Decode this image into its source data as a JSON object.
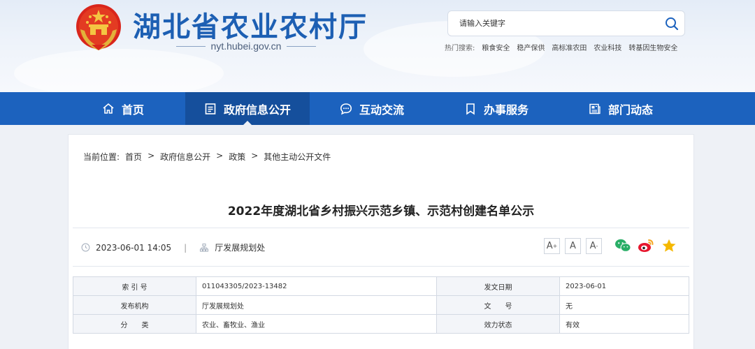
{
  "header": {
    "site_title": "湖北省农业农村厅",
    "domain": "nyt.hubei.gov.cn",
    "search": {
      "placeholder": "请输入关键字"
    },
    "hot_label": "热门搜索:",
    "hot_items": [
      "粮食安全",
      "稳产保供",
      "高标准农田",
      "农业科技",
      "转基因生物安全"
    ]
  },
  "nav": {
    "items": [
      {
        "label": "首页",
        "icon": "home-icon"
      },
      {
        "label": "政府信息公开",
        "icon": "document-list-icon",
        "active": true
      },
      {
        "label": "互动交流",
        "icon": "chat-bubble-icon"
      },
      {
        "label": "办事服务",
        "icon": "bookmark-icon"
      },
      {
        "label": "部门动态",
        "icon": "news-icon"
      }
    ]
  },
  "breadcrumb": {
    "label": "当前位置:",
    "items": [
      "首页",
      "政府信息公开",
      "政策",
      "其他主动公开文件"
    ],
    "separator": ">"
  },
  "article": {
    "title": "2022年度湖北省乡村振兴示范乡镇、示范村创建名单公示",
    "datetime": "2023-06-01 14:05",
    "separator": "|",
    "source": "厅发展规划处",
    "font_buttons": [
      "A",
      "A",
      "A"
    ],
    "font_button_marks": [
      "+",
      "",
      "-"
    ]
  },
  "info": {
    "rows": [
      {
        "k1": "索 引 号",
        "v1": "011043305/2023-13482",
        "k2": "发文日期",
        "v2": "2023-06-01"
      },
      {
        "k1": "发布机构",
        "v1": "厅发展规划处",
        "k2": "文　　号",
        "v2": "无"
      },
      {
        "k1": "分　　类",
        "v1": "农业、畜牧业、渔业",
        "k2": "效力状态",
        "v2": "有效"
      }
    ]
  },
  "colors": {
    "nav_bg": "#1c62be",
    "nav_active_bg": "#154f9c",
    "title_blue": "#1d5fb3",
    "wechat_green": "#2aae67",
    "weibo_red": "#e6162d",
    "star_yellow": "#f5b800"
  }
}
